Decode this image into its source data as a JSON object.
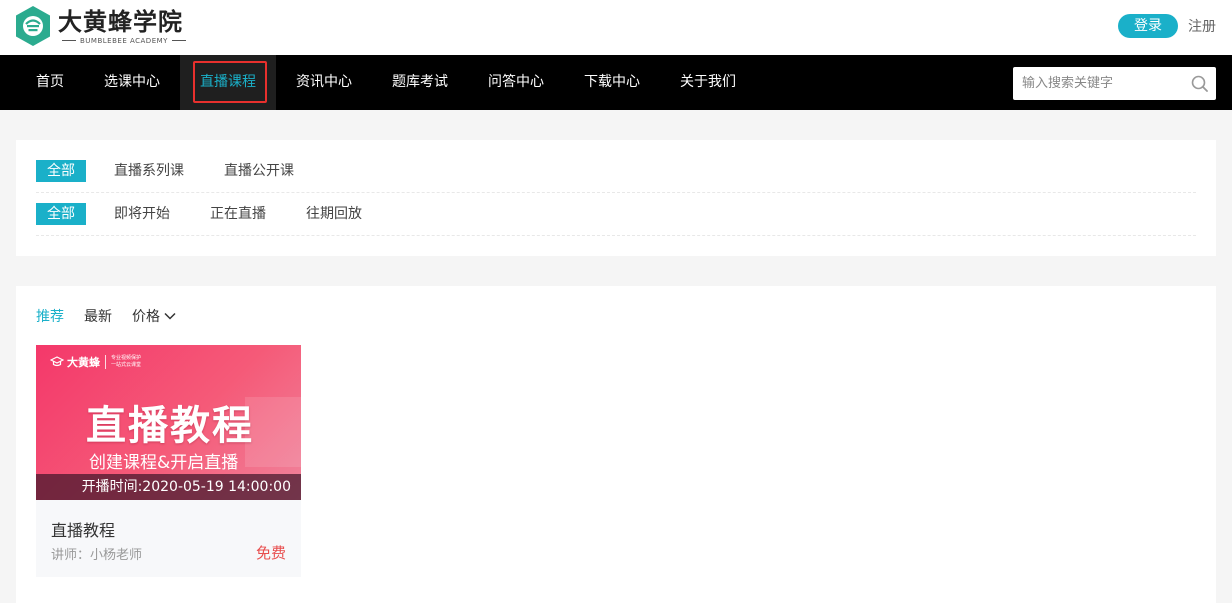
{
  "brand": {
    "title": "大黄蜂学院",
    "subtitle": "BUMBLEBEE ACADEMY",
    "accent": "#1ab0c9",
    "logo_color": "#2bab8f"
  },
  "auth": {
    "login": "登录",
    "register": "注册"
  },
  "nav": {
    "items": [
      {
        "label": "首页"
      },
      {
        "label": "选课中心"
      },
      {
        "label": "直播课程",
        "active": true
      },
      {
        "label": "资讯中心"
      },
      {
        "label": "题库考试"
      },
      {
        "label": "问答中心"
      },
      {
        "label": "下载中心"
      },
      {
        "label": "关于我们"
      }
    ],
    "search_placeholder": "输入搜索关键字",
    "search_icon": "search-icon"
  },
  "filters": {
    "row1": [
      "全部",
      "直播系列课",
      "直播公开课"
    ],
    "row2": [
      "全部",
      "即将开始",
      "正在直播",
      "往期回放"
    ]
  },
  "sort": {
    "items": [
      "推荐",
      "最新",
      "价格"
    ],
    "active": "推荐"
  },
  "courses": [
    {
      "thumb_brand": "大黄蜂",
      "thumb_slogan_1": "专业视频保护",
      "thumb_slogan_2": "一站式云课堂",
      "thumb_title": "直播教程",
      "thumb_subtitle": "创建课程&开启直播",
      "start_time": "开播时间:2020-05-19 14:00:00",
      "title": "直播教程",
      "teacher": "讲师：小杨老师",
      "price": "免费"
    }
  ]
}
